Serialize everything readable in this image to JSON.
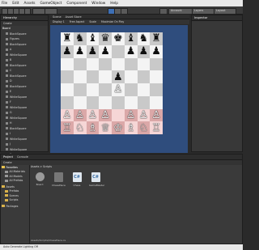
{
  "menu": {
    "items": [
      "File",
      "Edit",
      "Assets",
      "GameObject",
      "Component",
      "Window",
      "Help"
    ]
  },
  "toolbar": {
    "account_label": "Account",
    "layers_label": "Layers",
    "layout_label": "Layout"
  },
  "hierarchy": {
    "tab_label": "Hierarchy",
    "create_label": "Create",
    "scene_name": "Board",
    "items": [
      "BlackSquare",
      "Figures",
      "BlackSquare",
      "A",
      "WhiteSquare",
      "B",
      "BlackSquare",
      "C",
      "BlackSquare",
      "D",
      "BlackSquare",
      "E",
      "WhiteSquare",
      "F",
      "WhiteSquare",
      "G",
      "WhiteSquare",
      "H",
      "BlackSquare",
      "I",
      "WhiteSquare",
      "J",
      "WhiteSquare",
      "K",
      "BlackSquare",
      "L",
      "WhiteSquare",
      "M",
      "BlackSquare",
      "N",
      "WhiteSquare",
      "O",
      "BlackSquare"
    ]
  },
  "center_tabs": {
    "scene": "Scene",
    "asset_store": "Asset Store",
    "display": "Display 1",
    "aspect": "Free Aspect",
    "scale": "Scale",
    "maximize": "Maximize On Play"
  },
  "inspector": {
    "tab_label": "Inspector"
  },
  "board": {
    "highlight_color": "#dba8a8",
    "rows": [
      [
        "♜",
        "♞",
        "♝",
        "♛",
        "♚",
        "♝",
        "♞",
        "♜"
      ],
      [
        "♟",
        "♟",
        "♟",
        "♟",
        "",
        "♟",
        "♟",
        "♟"
      ],
      [
        "",
        "",
        "",
        "",
        "",
        "",
        "",
        ""
      ],
      [
        "",
        "",
        "",
        "",
        "♟",
        "",
        "",
        ""
      ],
      [
        "",
        "",
        "",
        "",
        "♙",
        "",
        "",
        ""
      ],
      [
        "",
        "",
        "",
        "",
        "",
        "",
        "",
        ""
      ],
      [
        "♙",
        "♙",
        "♙",
        "♙",
        "",
        "♙",
        "♙",
        "♙"
      ],
      [
        "♖",
        "♘",
        "♗",
        "♕",
        "♔",
        "♗",
        "♘",
        "♖"
      ]
    ],
    "highlight_rows": [
      6,
      7
    ]
  },
  "project": {
    "project_tab": "Project",
    "console_tab": "Console",
    "create_label": "Create",
    "breadcrumb": "Assets > Scripts",
    "favorites_label": "Favorites",
    "favorites": [
      "All Materials",
      "All Models",
      "All Prefabs"
    ],
    "assets_label": "Assets",
    "asset_folders": [
      "Prefabs",
      "Scenes",
      "Scripts"
    ],
    "packages_label": "Packages",
    "items": [
      {
        "name": "Board",
        "icon": "gear"
      },
      {
        "name": "ChessPiece",
        "icon": "piece"
      },
      {
        "name": "Chess",
        "icon": "cs"
      },
      {
        "name": "GameMaster",
        "icon": "cs"
      }
    ]
  },
  "status": {
    "path": "Assets/Scripts/ChessPiece.cs",
    "message": "Auto Generate Lighting Off"
  }
}
